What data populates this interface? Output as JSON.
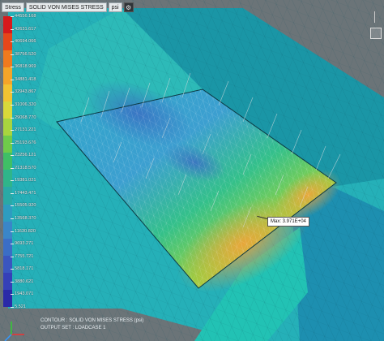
{
  "toolbar": {
    "result_type": "Stress",
    "component": "SOLID VON MISES STRESS",
    "unit": "psi",
    "settings_icon": "gear-icon"
  },
  "legend": {
    "ticks": [
      "44556.168",
      "42631.617",
      "40694.066",
      "38756.520",
      "36818.969",
      "34881.418",
      "32943.867",
      "31006.320",
      "29068.770",
      "27131.221",
      "25193.676",
      "23256.121",
      "21318.570",
      "19381.021",
      "17443.471",
      "15505.920",
      "13568.370",
      "11630.820",
      "9693.271",
      "7755.721",
      "5818.171",
      "3880.621",
      "1943.071",
      "5.521"
    ],
    "colors": [
      "#d7191c",
      "#e6461a",
      "#f07a1e",
      "#f4a429",
      "#f1c232",
      "#d9d93a",
      "#a8d43f",
      "#6fcb4a",
      "#3fbf66",
      "#2fb58a",
      "#2aa9a6",
      "#2e9cc0",
      "#3a86c8",
      "#3b6ec6",
      "#3a56c0",
      "#3540b8",
      "#2a2aa8"
    ]
  },
  "max_label": "Max: 3.971E+04",
  "bottom": {
    "contour": "CONTOUR : SOLID VON MISES STRESS (psi)",
    "output": "OUTPUT SET : LOADCASE 1"
  },
  "axes": {
    "x": "X",
    "y": "Y",
    "z": "Z"
  }
}
